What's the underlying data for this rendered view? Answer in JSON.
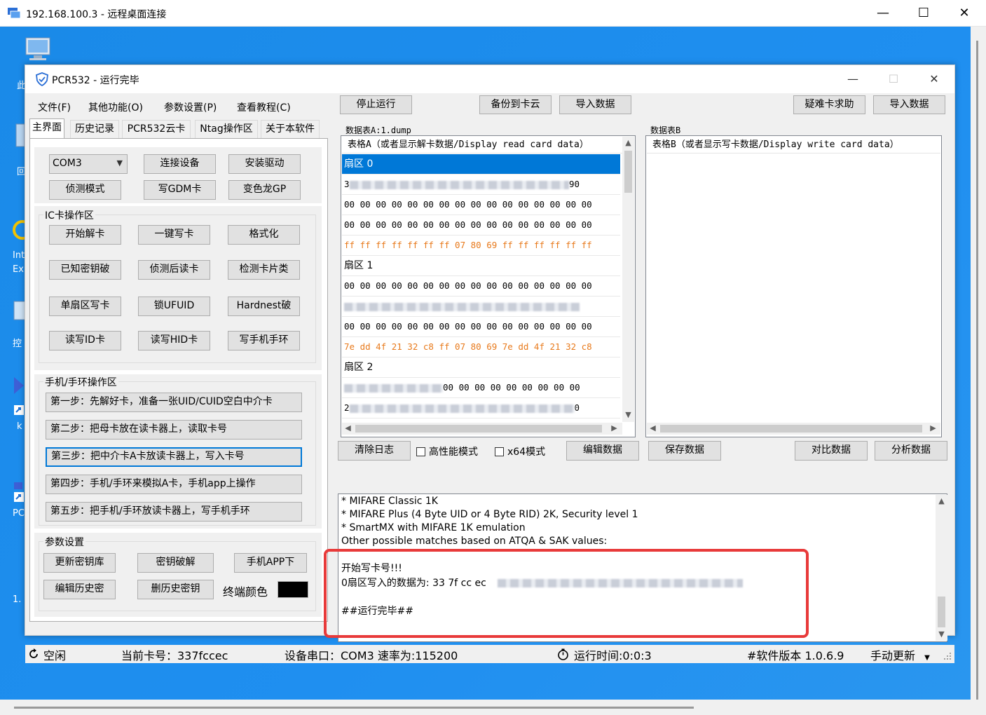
{
  "rdp": {
    "title": "192.168.100.3 - 远程桌面连接",
    "minimize": "—",
    "maximize": "☐",
    "close": "✕"
  },
  "desktop": {
    "labels": [
      "此",
      "回",
      "Int",
      "Ex",
      "控",
      "k",
      "PC",
      "1."
    ]
  },
  "app": {
    "title": "PCR532 - 运行完毕",
    "minimize": "—",
    "maximize": "☐",
    "close": "✕"
  },
  "menu": [
    "文件(F)",
    "其他功能(O)",
    "参数设置(P)",
    "查看教程(C)"
  ],
  "toolbar": {
    "stop": "停止运行",
    "backup_cloud": "备份到卡云",
    "import_a": "导入数据",
    "help_hard": "疑难卡求助",
    "import_b": "导入数据"
  },
  "tabs": [
    "主界面",
    "历史记录",
    "PCR532云卡",
    "Ntag操作区",
    "关于本软件"
  ],
  "main": {
    "com_port": "COM3",
    "connect": "连接设备",
    "install_driver": "安装驱动",
    "detect_mode": "侦测模式",
    "write_gdm": "写GDM卡",
    "chameleon_gp": "变色龙GP",
    "ic_group_label": "IC卡操作区",
    "ic_buttons": [
      "开始解卡",
      "一键写卡",
      "格式化",
      "已知密钥破",
      "侦测后读卡",
      "检测卡片类",
      "单扇区写卡",
      "锁UFUID",
      "Hardnest破",
      "读写ID卡",
      "读写HID卡",
      "写手机手环"
    ],
    "phone_group_label": "手机/手环操作区",
    "phone_steps": [
      "第一步：先解好卡，准备一张UID/CUID空白中介卡",
      "第二步：把母卡放在读卡器上，读取卡号",
      "第三步：把中介卡A卡放读卡器上，写入卡号",
      "第四步：手机/手环来模拟A卡，手机app上操作",
      "第五步：把手机/手环放读卡器上，写手机手环"
    ],
    "param_group_label": "参数设置",
    "update_keys": "更新密钥库",
    "key_crack": "密钥破解",
    "phone_app": "手机APP下",
    "edit_history": "编辑历史密",
    "delete_history": "删历史密钥",
    "terminal_color_label": "终端颜色"
  },
  "table_a": {
    "caption": "数据表A:1.dump",
    "header": "表格A（或者显示解卡数据/Display read card data）",
    "rows": [
      {
        "text": "扇区 0",
        "kind": "sector",
        "selected": true
      },
      {
        "text": "3",
        "kind": "masked",
        "suffix": "90"
      },
      {
        "text": "00 00 00 00 00 00 00 00 00 00 00 00 00 00 00 00",
        "kind": "data"
      },
      {
        "text": "00 00 00 00 00 00 00 00 00 00 00 00 00 00 00 00",
        "kind": "data"
      },
      {
        "text": "ff ff ff ff ff ff ff 07 80 69 ff ff ff ff ff ff",
        "kind": "trailer"
      },
      {
        "text": "扇区 1",
        "kind": "sector"
      },
      {
        "text": "00 00 00 00 00 00 00 00 00 00 00 00 00 00 00 00",
        "kind": "data"
      },
      {
        "text": "",
        "kind": "masked",
        "suffix": ""
      },
      {
        "text": "00 00 00 00 00 00 00 00 00 00 00 00 00 00 00 00",
        "kind": "data"
      },
      {
        "text": "7e dd 4f 21 32 c8 ff 07 80 69 7e dd 4f 21 32 c8",
        "kind": "trailer"
      },
      {
        "text": "扇区 2",
        "kind": "sector"
      },
      {
        "text": "",
        "kind": "masked",
        "suffix": "00 00 00 00 00 00 00 00 00"
      },
      {
        "text": "2",
        "kind": "masked",
        "suffix": "0"
      }
    ]
  },
  "table_b": {
    "caption": "数据表B",
    "header": "表格B（或者显示写卡数据/Display write card data）"
  },
  "actions": {
    "clear_log": "清除日志",
    "high_perf": "高性能模式",
    "x64_mode": "x64模式",
    "edit_data": "编辑数据",
    "save_data": "保存数据",
    "compare_data": "对比数据",
    "analyze_data": "分析数据"
  },
  "log": {
    "lines": [
      "* MIFARE Classic 1K",
      "* MIFARE Plus (4 Byte UID or 4 Byte RID) 2K, Security level 1",
      "* SmartMX with MIFARE 1K emulation",
      "Other possible matches based on ATQA & SAK values:",
      "",
      "开始写卡号!!!",
      "0扇区写入的数据为: 33  7f  cc  ec",
      "",
      "##运行完毕##"
    ]
  },
  "status": {
    "state": "空闲",
    "card_no": "当前卡号：337fccec",
    "serial": "设备串口：COM3 速率为:115200",
    "run_time": "运行时间:0:0:3",
    "version": "#软件版本 1.0.6.9",
    "manual_update": "手动更新"
  },
  "colors": {
    "accent": "#0078d7",
    "desktop": "#1a8ae8",
    "trailer_text": "#e87a1c",
    "highlight_box": "#e83a3a",
    "terminal_color": "#000000"
  }
}
